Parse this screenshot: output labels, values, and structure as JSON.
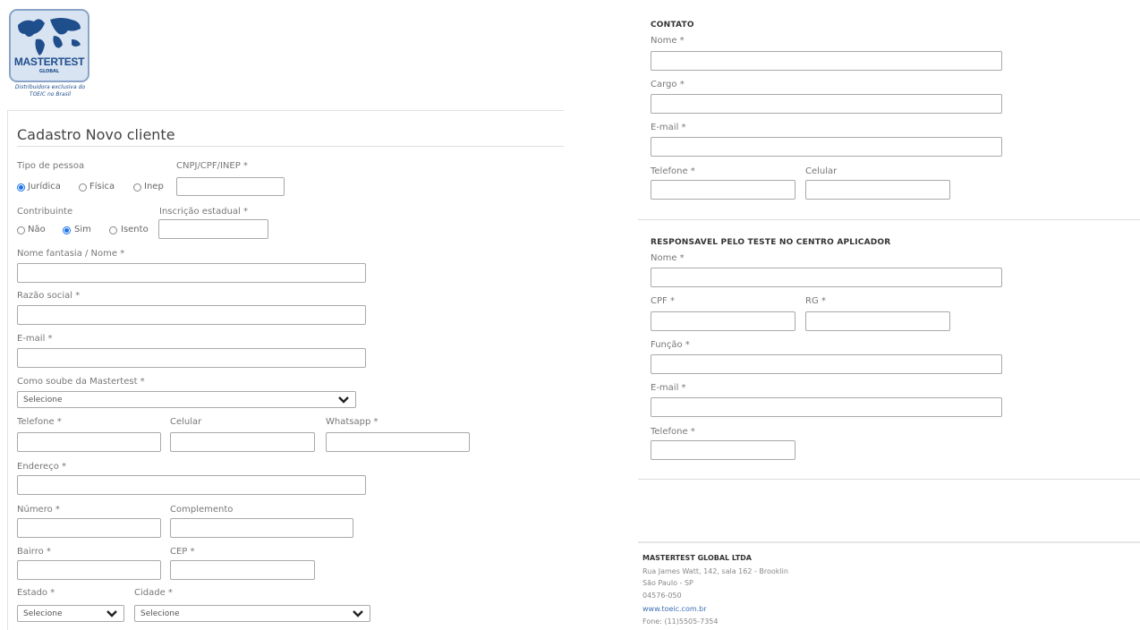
{
  "logo": {
    "brand": "MASTERTEST",
    "sub": "GLOBAL",
    "caption_line1": "Distribuidora exclusiva do",
    "caption_line2": "TOEIC no Brasil"
  },
  "left": {
    "title": "Cadastro Novo cliente",
    "tipo_pessoa": {
      "label": "Tipo de pessoa",
      "options": [
        "Jurídica",
        "Física",
        "Inep"
      ],
      "selected": "Jurídica"
    },
    "cnpj_label": "CNPJ/CPF/INEP *",
    "contribuinte": {
      "label": "Contribuinte",
      "options": [
        "Não",
        "Sim",
        "Isento"
      ],
      "selected": "Sim"
    },
    "inscricao_label": "Inscrição estadual *",
    "nome_fantasia_label": "Nome fantasia / Nome *",
    "razao_social_label": "Razão social *",
    "email_label": "E-mail *",
    "como_soube_label": "Como soube da Mastertest *",
    "como_soube_value": "Selecione",
    "telefone_label": "Telefone *",
    "celular_label": "Celular",
    "whatsapp_label": "Whatsapp *",
    "endereco_label": "Endereço *",
    "numero_label": "Número *",
    "complemento_label": "Complemento",
    "bairro_label": "Bairro *",
    "cep_label": "CEP *",
    "estado_label": "Estado *",
    "estado_value": "Selecione",
    "cidade_label": "Cidade *",
    "cidade_value": "Selecione"
  },
  "contato": {
    "heading": "CONTATO",
    "nome_label": "Nome *",
    "cargo_label": "Cargo *",
    "email_label": "E-mail *",
    "telefone_label": "Telefone *",
    "celular_label": "Celular"
  },
  "responsavel": {
    "heading": "RESPONSAVEL PELO TESTE NO CENTRO APLICADOR",
    "nome_label": "Nome *",
    "cpf_label": "CPF *",
    "rg_label": "RG *",
    "funcao_label": "Função *",
    "email_label": "E-mail *",
    "telefone_label": "Telefone *"
  },
  "footer": {
    "company": "MASTERTEST GLOBAL LTDA",
    "address": "Rua James Watt, 142, sala 162 - Brooklin",
    "city": "São Paulo - SP",
    "zip": "04576-050",
    "website": "www.toeic.com.br",
    "phone": "Fone: (11)5505-7354"
  },
  "colors": {
    "radio_selected": "#1a73e8",
    "logo_blue": "#1f4e8c",
    "link": "#3b6fb6"
  }
}
